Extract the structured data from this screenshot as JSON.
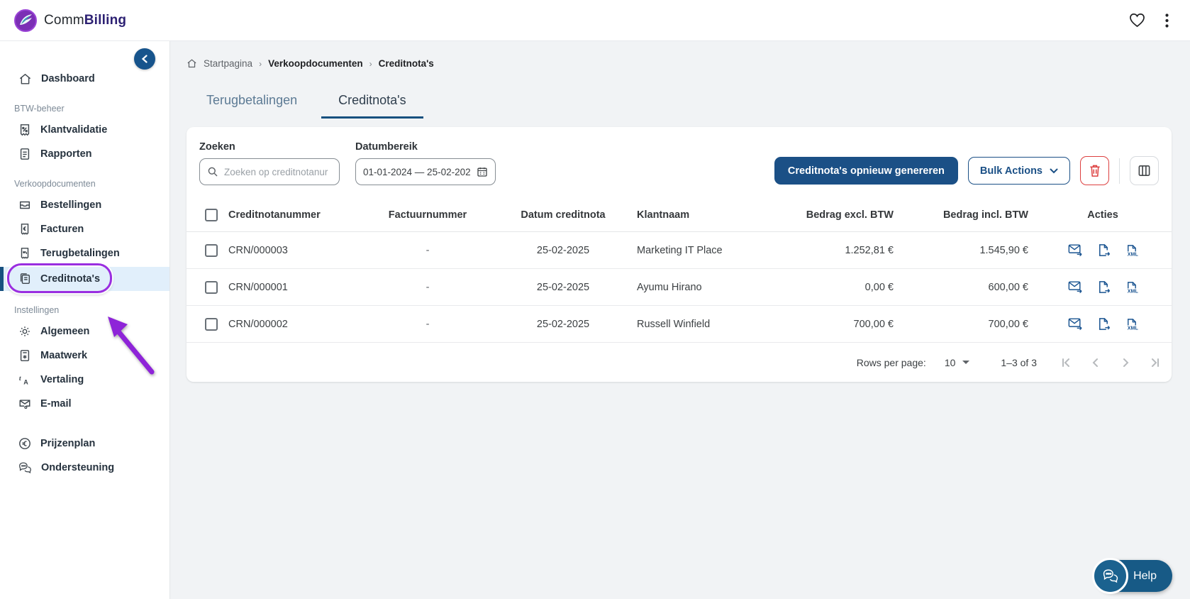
{
  "colors": {
    "primary_navy": "#1b5086",
    "tab_underline": "#17507f",
    "selected_item_bg": "#e1effb",
    "annotation_purple": "#9a2ee0",
    "danger_red": "#dd4040",
    "brand_purple": "#2d2173",
    "help_navy": "#175a86",
    "main_bg": "#f1f3f5"
  },
  "topbar": {
    "brand_prefix": "Comm",
    "brand_suffix": "Billing"
  },
  "sidebar": {
    "sections": [
      {
        "items": [
          {
            "label": "Dashboard",
            "icon": "home-icon"
          }
        ]
      },
      {
        "title": "BTW-beheer",
        "items": [
          {
            "label": "Klantvalidatie",
            "icon": "receipt-percent-icon"
          },
          {
            "label": "Rapporten",
            "icon": "report-icon"
          }
        ]
      },
      {
        "title": "Verkoopdocumenten",
        "items": [
          {
            "label": "Bestellingen",
            "icon": "orders-icon"
          },
          {
            "label": "Facturen",
            "icon": "invoice-euro-icon"
          },
          {
            "label": "Terugbetalingen",
            "icon": "refund-icon"
          },
          {
            "label": "Creditnota's",
            "icon": "credit-note-icon",
            "selected": true
          }
        ]
      },
      {
        "title": "Instellingen",
        "items": [
          {
            "label": "Algemeen",
            "icon": "gear-icon"
          },
          {
            "label": "Maatwerk",
            "icon": "custom-doc-icon"
          },
          {
            "label": "Vertaling",
            "icon": "translate-icon"
          },
          {
            "label": "E-mail",
            "icon": "mail-gear-icon"
          }
        ]
      },
      {
        "items": [
          {
            "label": "Prijzenplan",
            "icon": "euro-circle-icon"
          },
          {
            "label": "Ondersteuning",
            "icon": "support-chat-icon"
          }
        ]
      }
    ]
  },
  "breadcrumb": {
    "items": [
      "Startpagina",
      "Verkoopdocumenten",
      "Creditnota's"
    ]
  },
  "tabs": [
    {
      "label": "Terugbetalingen",
      "active": false
    },
    {
      "label": "Creditnota's",
      "active": true
    }
  ],
  "filters": {
    "search_label": "Zoeken",
    "search_placeholder": "Zoeken op creditnotanur",
    "date_label": "Datumbereik",
    "date_value": "01-01-2024 — 25-02-202"
  },
  "toolbar": {
    "regenerate_label": "Creditnota's opnieuw genereren",
    "bulk_actions_label": "Bulk Actions"
  },
  "table": {
    "columns": [
      "Creditnotanummer",
      "Factuurnummer",
      "Datum creditnota",
      "Klantnaam",
      "Bedrag excl. BTW",
      "Bedrag incl. BTW",
      "Acties"
    ],
    "rows": [
      {
        "number": "CRN/000003",
        "invoice": "-",
        "date": "25-02-2025",
        "customer": "Marketing IT Place",
        "amount_excl": "1.252,81 €",
        "amount_incl": "1.545,90 €"
      },
      {
        "number": "CRN/000001",
        "invoice": "-",
        "date": "25-02-2025",
        "customer": "Ayumu Hirano",
        "amount_excl": "0,00 €",
        "amount_incl": "600,00 €"
      },
      {
        "number": "CRN/000002",
        "invoice": "-",
        "date": "25-02-2025",
        "customer": "Russell Winfield",
        "amount_excl": "700,00 €",
        "amount_incl": "700,00 €"
      }
    ]
  },
  "pagination": {
    "rows_per_page_label": "Rows per page:",
    "rows_per_page_value": "10",
    "range_text": "1–3 of 3"
  },
  "help": {
    "label": "Help"
  }
}
